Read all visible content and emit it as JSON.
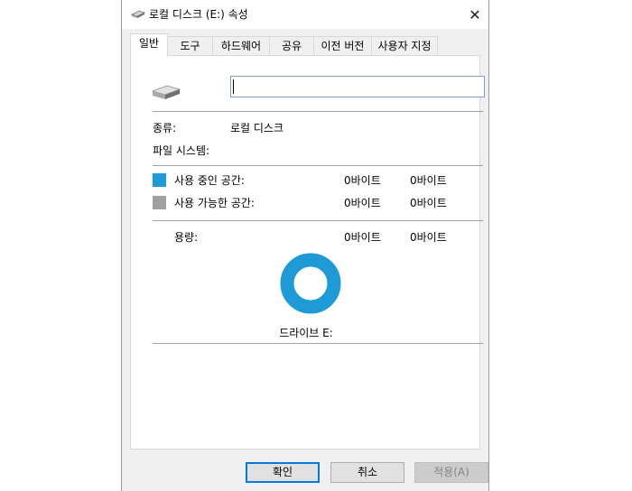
{
  "window": {
    "title": "로컬 디스크 (E:) 속성",
    "close_glyph": "✕"
  },
  "tabs": [
    {
      "label": "일반",
      "active": true
    },
    {
      "label": "도구"
    },
    {
      "label": "하드웨어"
    },
    {
      "label": "공유"
    },
    {
      "label": "이전 버전"
    },
    {
      "label": "사용자 지정"
    }
  ],
  "general": {
    "name_value": "",
    "type_label": "종류:",
    "type_value": "로컬 디스크",
    "fs_label": "파일 시스템:",
    "fs_value": "",
    "used_label": "사용 중인 공간:",
    "used_bytes": "0바이트",
    "used_size": "0바이트",
    "free_label": "사용 가능한 공간:",
    "free_bytes": "0바이트",
    "free_size": "0바이트",
    "capacity_label": "용량:",
    "capacity_bytes": "0바이트",
    "capacity_size": "0바이트",
    "drive_label": "드라이브 E:"
  },
  "colors": {
    "used": "#1e9bd7",
    "free": "#a0a0a0",
    "accent": "#0078d7"
  },
  "buttons": {
    "ok": "확인",
    "cancel": "취소",
    "apply": "적용(A)"
  }
}
